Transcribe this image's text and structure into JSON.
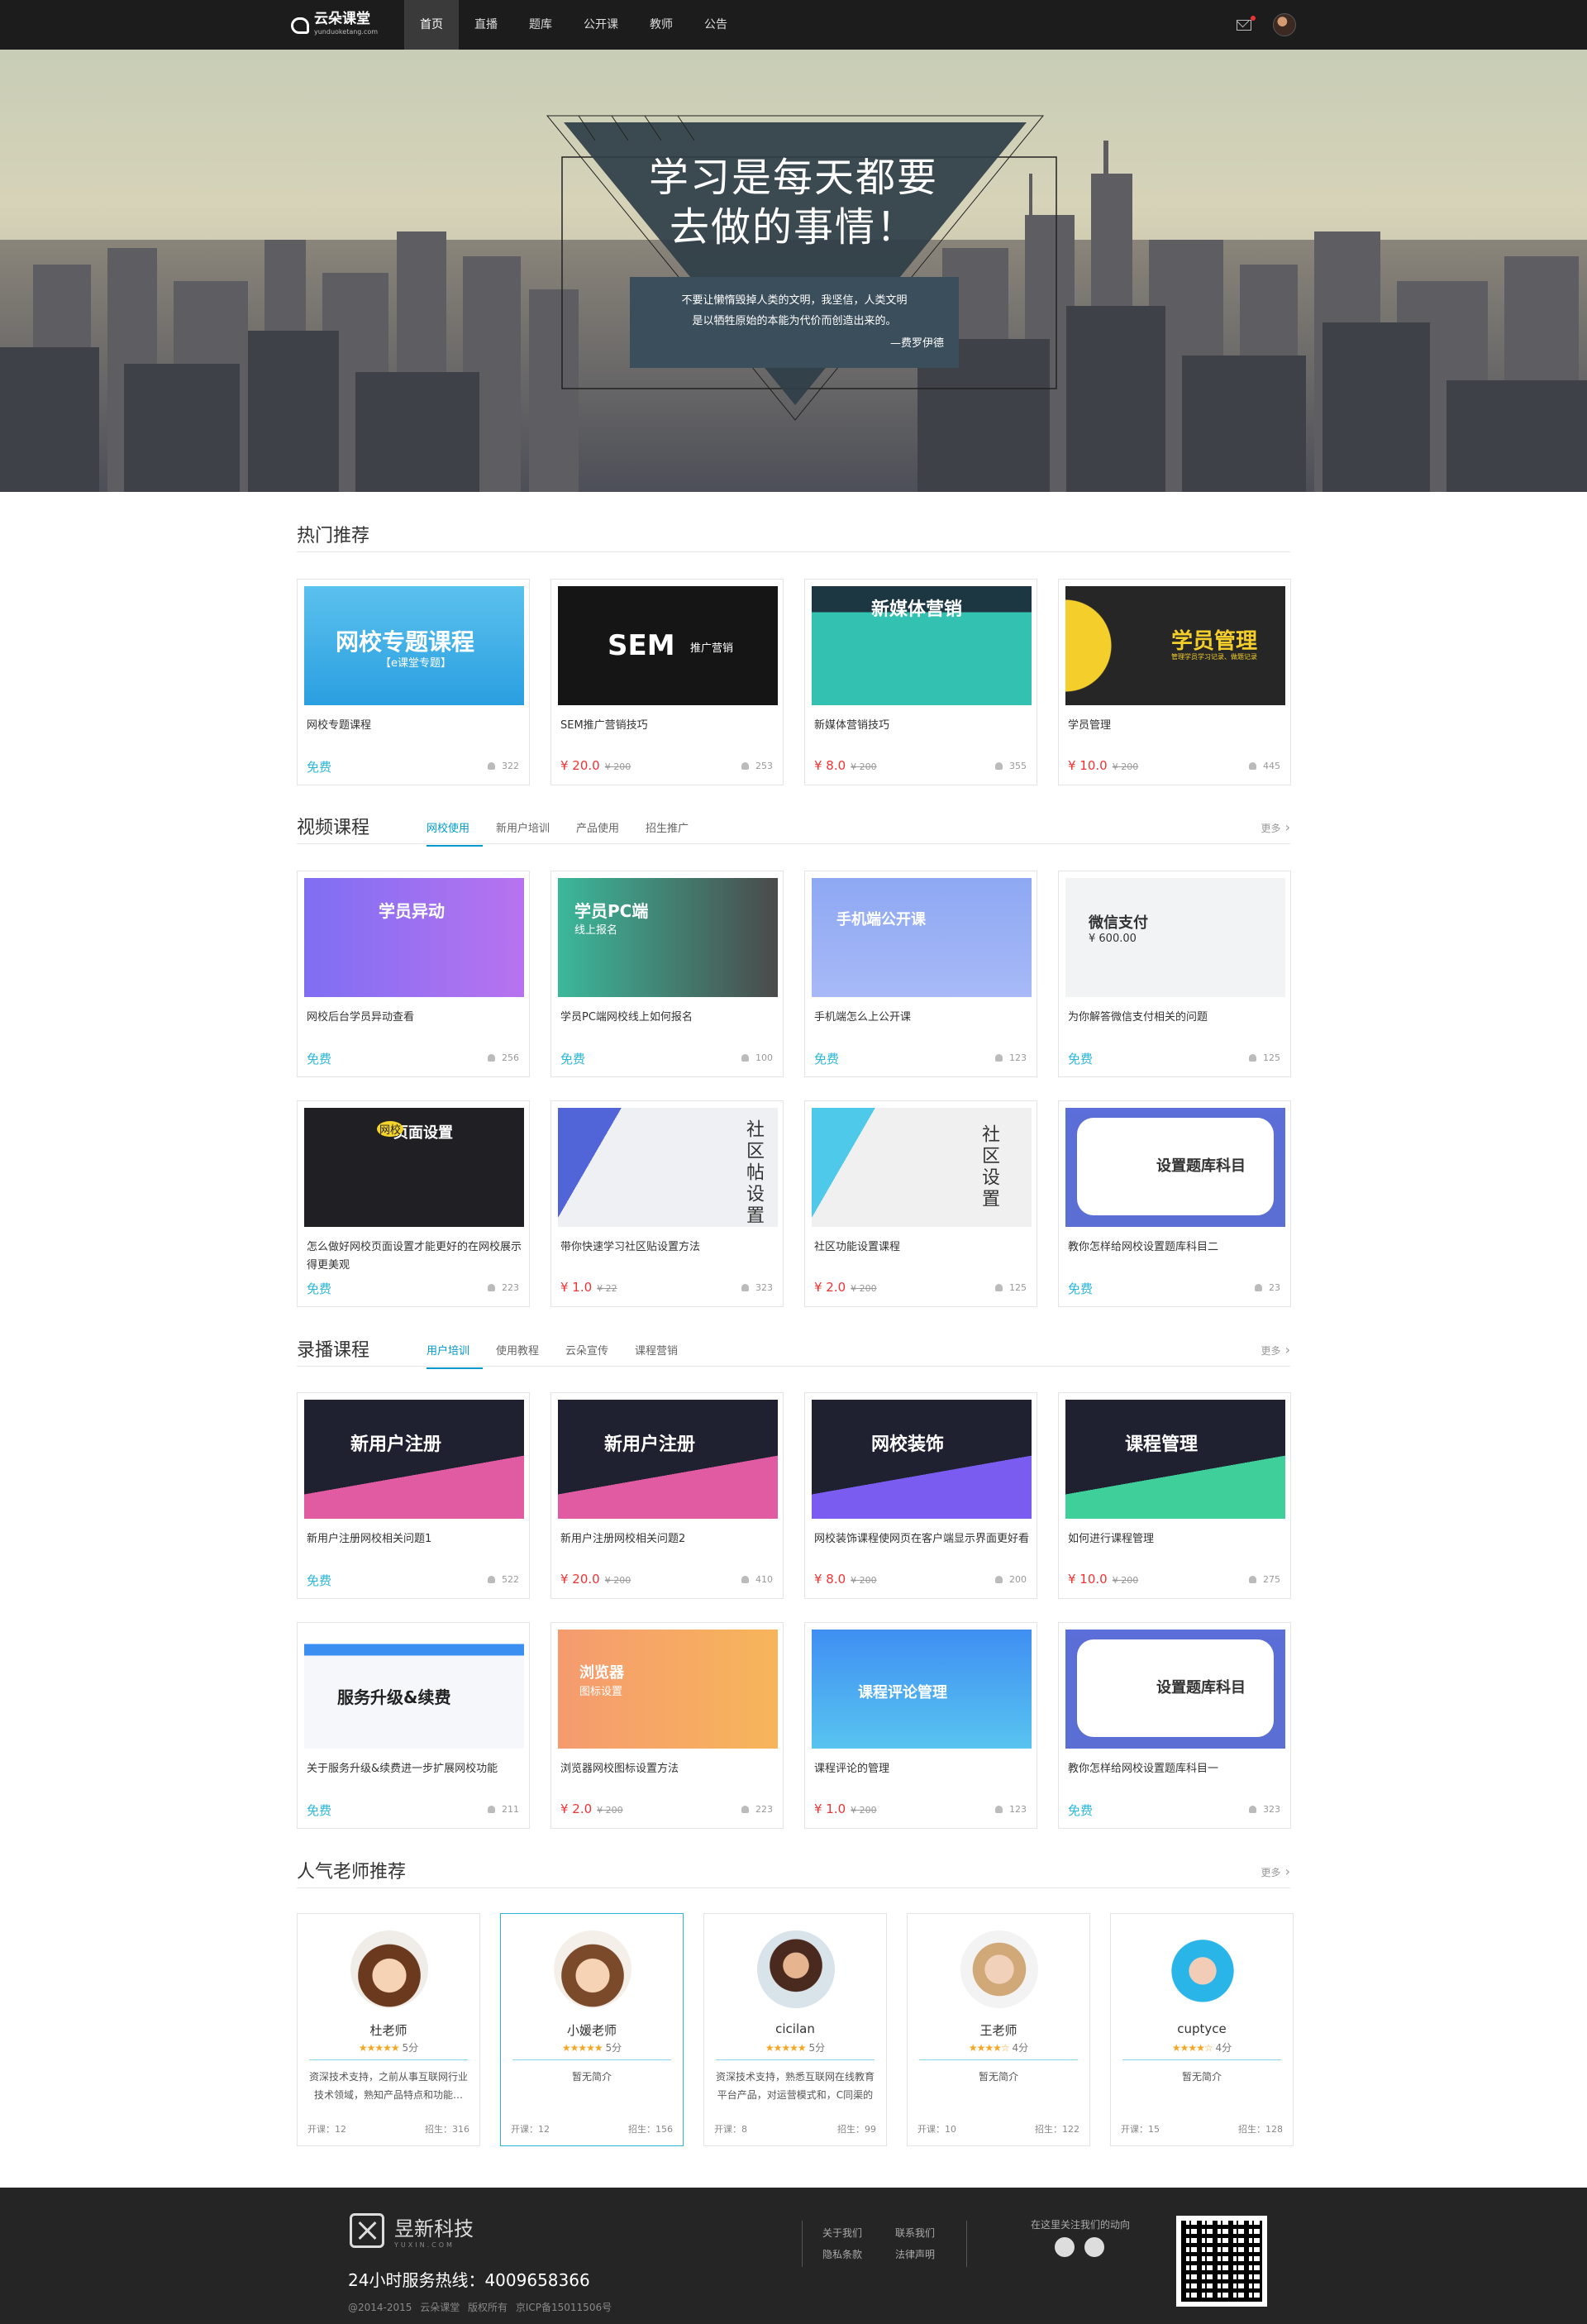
{
  "nav": {
    "logo_text": "云朵课堂",
    "logo_sub": "yunduoketang.com",
    "menu": [
      "首页",
      "直播",
      "题库",
      "公开课",
      "教师",
      "公告"
    ],
    "active_index": 0
  },
  "banner": {
    "slogan_line1": "学习是每天都要",
    "slogan_line2": "去做的事情！",
    "quote_line1": "不要让懒惰毁掉人类的文明，我坚信，人类文明",
    "quote_line2": "是以牺牲原始的本能为代价而创造出来的。",
    "quote_author": "—费罗伊德"
  },
  "hot": {
    "title": "热门推荐",
    "cards": [
      {
        "thumb_text": "网校专题课程",
        "thumb_sub": "【e课堂专题】",
        "title": "网校专题课程",
        "price": "免费",
        "old_price": "",
        "count": "322",
        "free": true
      },
      {
        "thumb_text": "SEM",
        "thumb_sub": "推广营销",
        "title": "SEM推广营销技巧",
        "price": "¥ 20.0",
        "old_price": "¥ 200",
        "count": "253",
        "free": false
      },
      {
        "thumb_text": "新媒体营销",
        "thumb_sub": "",
        "title": "新媒体营销技巧",
        "price": "¥ 8.0",
        "old_price": "¥ 200",
        "count": "355",
        "free": false
      },
      {
        "thumb_text": "学员管理",
        "thumb_sub": "管理学员学习记录、做题记录",
        "title": "学员管理",
        "price": "¥ 10.0",
        "old_price": "¥ 200",
        "count": "445",
        "free": false
      }
    ]
  },
  "video": {
    "title": "视频课程",
    "tabs": [
      "网校使用",
      "新用户培训",
      "产品使用",
      "招生推广"
    ],
    "more": "更多",
    "cards": [
      {
        "thumb_text": "学员异动",
        "thumb_sub": "",
        "title": "网校后台学员异动查看",
        "price": "免费",
        "old_price": "",
        "count": "256",
        "free": true
      },
      {
        "thumb_text": "学员PC端",
        "thumb_sub": "线上报名",
        "title": "学员PC端网校线上如何报名",
        "price": "免费",
        "old_price": "",
        "count": "100",
        "free": true
      },
      {
        "thumb_text": "手机端公开课",
        "thumb_sub": "",
        "title": "手机端怎么上公开课",
        "price": "免费",
        "old_price": "",
        "count": "123",
        "free": true
      },
      {
        "thumb_text": "微信支付",
        "thumb_sub": "¥ 600.00",
        "title": "为你解答微信支付相关的问题",
        "price": "免费",
        "old_price": "",
        "count": "125",
        "free": true
      },
      {
        "thumb_text": "页面设置",
        "thumb_sub": "网校",
        "title": "怎么做好网校页面设置才能更好的在网校展示得更美观",
        "price": "免费",
        "old_price": "",
        "count": "223",
        "free": true
      },
      {
        "thumb_text": "社区帖设置",
        "thumb_sub": "",
        "title": "带你快速学习社区贴设置方法",
        "price": "¥ 1.0",
        "old_price": "¥ 22",
        "count": "323",
        "free": false
      },
      {
        "thumb_text": "社区设置",
        "thumb_sub": "",
        "title": "社区功能设置课程",
        "price": "¥ 2.0",
        "old_price": "¥ 200",
        "count": "125",
        "free": false
      },
      {
        "thumb_text": "设置题库科目",
        "thumb_sub": "",
        "title": "教你怎样给网校设置题库科目二",
        "price": "免费",
        "old_price": "",
        "count": "23",
        "free": true
      }
    ]
  },
  "record": {
    "title": "录播课程",
    "tabs": [
      "用户培训",
      "使用教程",
      "云朵宣传",
      "课程营销"
    ],
    "more": "更多",
    "cards": [
      {
        "thumb_text": "新用户注册",
        "thumb_sub": "",
        "title": "新用户注册网校相关问题1",
        "price": "免费",
        "old_price": "",
        "count": "522",
        "free": true
      },
      {
        "thumb_text": "新用户注册",
        "thumb_sub": "",
        "title": "新用户注册网校相关问题2",
        "price": "¥ 20.0",
        "old_price": "¥ 200",
        "count": "410",
        "free": false
      },
      {
        "thumb_text": "网校装饰",
        "thumb_sub": "",
        "title": "网校装饰课程使网页在客户端显示界面更好看",
        "price": "¥ 8.0",
        "old_price": "¥ 200",
        "count": "200",
        "free": false
      },
      {
        "thumb_text": "课程管理",
        "thumb_sub": "",
        "title": "如何进行课程管理",
        "price": "¥ 10.0",
        "old_price": "¥ 200",
        "count": "275",
        "free": false
      },
      {
        "thumb_text": "服务升级&续费",
        "thumb_sub": "",
        "title": "关于服务升级&续费进一步扩展网校功能",
        "price": "免费",
        "old_price": "",
        "count": "211",
        "free": true
      },
      {
        "thumb_text": "浏览器",
        "thumb_sub": "图标设置",
        "title": "浏览器网校图标设置方法",
        "price": "¥ 2.0",
        "old_price": "¥ 200",
        "count": "223",
        "free": false
      },
      {
        "thumb_text": "课程评论管理",
        "thumb_sub": "",
        "title": "课程评论的管理",
        "price": "¥ 1.0",
        "old_price": "¥ 200",
        "count": "123",
        "free": false
      },
      {
        "thumb_text": "设置题库科目",
        "thumb_sub": "",
        "title": "教你怎样给网校设置题库科目一",
        "price": "免费",
        "old_price": "",
        "count": "323",
        "free": true
      }
    ]
  },
  "teachers": {
    "title": "人气老师推荐",
    "more": "更多",
    "items": [
      {
        "name": "杜老师",
        "stars": "★★★★★",
        "rating": "5分",
        "desc": "资深技术支持，之前从事互联网行业技术领域，熟知产品特点和功能…",
        "courses": "开课：12",
        "students": "招生：316"
      },
      {
        "name": "小媛老师",
        "stars": "★★★★★",
        "rating": "5分",
        "desc": "暂无简介",
        "courses": "开课：12",
        "students": "招生：156"
      },
      {
        "name": "cicilan",
        "stars": "★★★★★",
        "rating": "5分",
        "desc": "资深技术支持，熟悉互联网在线教育平台产品，对运营模式和，C同渠的行",
        "courses": "开课：8",
        "students": "招生：99"
      },
      {
        "name": "王老师",
        "stars": "★★★★☆",
        "rating": "4分",
        "desc": "暂无简介",
        "courses": "开课：10",
        "students": "招生：122"
      },
      {
        "name": "cuptyce",
        "stars": "★★★★☆",
        "rating": "4分",
        "desc": "暂无简介",
        "courses": "开课：15",
        "students": "招生：128"
      }
    ]
  },
  "footer": {
    "brand": "昱新科技",
    "brand_en": "YUXIN.COM",
    "hotline": "24小时服务热线：4009658366",
    "copyright": "@2014-2015 云朵课堂 版权所有 京ICP备15011506号",
    "links": [
      "关于我们",
      "联系我们",
      "隐私条款",
      "法律声明"
    ],
    "follow": "在这里关注我们的动向"
  }
}
